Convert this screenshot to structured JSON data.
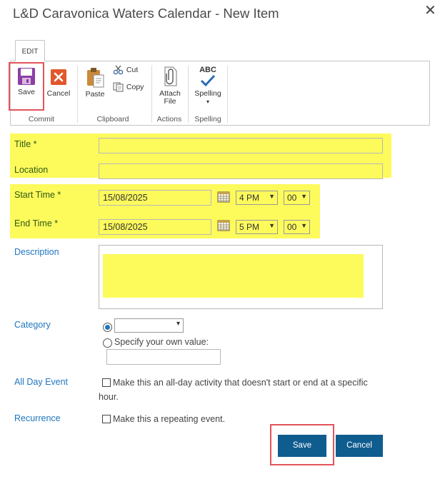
{
  "window": {
    "title": "L&D Caravonica Waters Calendar - New Item",
    "close_glyph": "✕"
  },
  "ribbon": {
    "tab": "EDIT",
    "groups": {
      "commit": "Commit",
      "clipboard": "Clipboard",
      "actions": "Actions",
      "spelling": "Spelling"
    },
    "buttons": {
      "save": "Save",
      "cancel": "Cancel",
      "paste": "Paste",
      "cut": "Cut",
      "copy": "Copy",
      "attach_line1": "Attach",
      "attach_line2": "File",
      "spelling": "Spelling",
      "spelling_icon_text": "ABC"
    }
  },
  "form": {
    "title_label": "Title *",
    "location_label": "Location",
    "start_label": "Start Time *",
    "end_label": "End Time *",
    "description_label": "Description",
    "category_label": "Category",
    "all_day_label": "All Day Event",
    "recurrence_label": "Recurrence",
    "start": {
      "date": "15/08/2025",
      "hour": "4 PM",
      "minute": "00"
    },
    "end": {
      "date": "15/08/2025",
      "hour": "5 PM",
      "minute": "00"
    },
    "category_custom_text": "Specify your own value:",
    "all_day_text_line1": "Make this an all-day activity that doesn't start or end at a specific",
    "all_day_text_line2": "hour.",
    "recurrence_text": "Make this a repeating event."
  },
  "footer": {
    "save": "Save",
    "cancel": "Cancel"
  },
  "colors": {
    "highlight": "#fdfa5c",
    "label_blue": "#1f76bf",
    "label_green": "#2f5b11",
    "button_blue": "#0f5c8f",
    "annotation_red": "#e3535c"
  }
}
